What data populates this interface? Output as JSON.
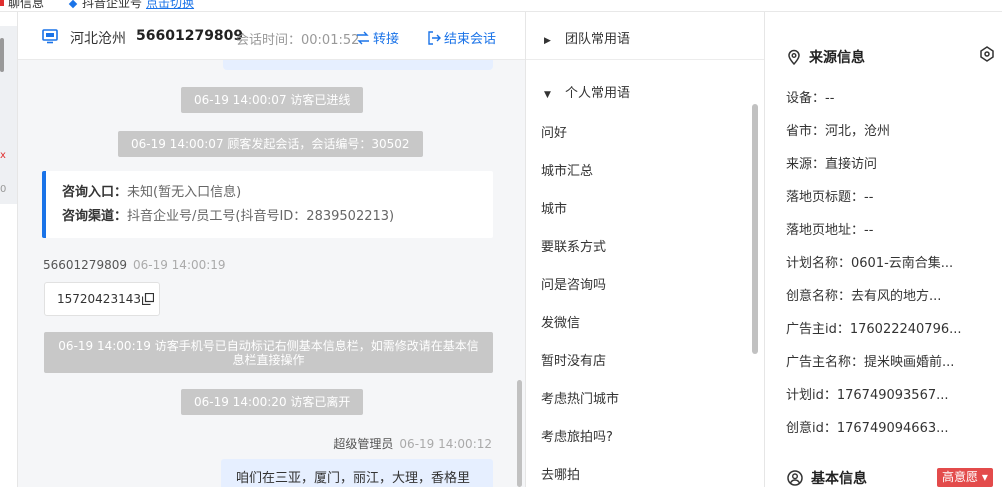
{
  "top_strip": {
    "fragment_left": "聊信息",
    "fragment_mid": "抖音企业号",
    "fragment_link": "点击切换"
  },
  "left_stub": {
    "tick_a": "x",
    "tick_b": "0"
  },
  "chat": {
    "header": {
      "region": "河北沧州",
      "visitor_id": "56601279809",
      "session_time_label": "会话时间：00:01:52",
      "transfer_label": "转接",
      "end_label": "结束会话"
    },
    "system_messages": {
      "entered": "06-19 14:00:07 访客已进线",
      "started": "06-19 14:00:07 顾客发起会话，会话编号：30502",
      "auto_mark": "06-19 14:00:19 访客手机号已自动标记右侧基本信息栏，如需修改请在基本信息栏直接操作",
      "left": "06-19 14:00:20 访客已离开"
    },
    "entry_card": {
      "entry_key": "咨询入口：",
      "entry_value": "未知(暂无入口信息)",
      "channel_key": "咨询渠道：",
      "channel_value": "抖音企业号/员工号(抖音号ID：2839502213)"
    },
    "customer_message": {
      "sender": "56601279809",
      "time": "06-19 14:00:19",
      "text": "15720423143"
    },
    "agent_message": {
      "sender": "超级管理员",
      "time": "06-19 14:00:12",
      "text": "咱们在三亚，厦门，丽江，大理，香格里"
    }
  },
  "phrases": {
    "team_group": "团队常用语",
    "personal_group": "个人常用语",
    "items": [
      "问好",
      "城市汇总",
      "城市",
      "要联系方式",
      "问是咨询吗",
      "发微信",
      "暂时没有店",
      "考虑热门城市",
      "考虑旅拍吗?",
      "去哪拍"
    ]
  },
  "info": {
    "source_title": "来源信息",
    "rows": [
      "设备：--",
      "省市：河北，沧州",
      "来源：直接访问",
      "落地页标题：--",
      "落地页地址：--",
      "计划名称：0601-云南合集...",
      "创意名称：去有风的地方...",
      "广告主id：176022240796...",
      "广告主名称：提米映画婚前...",
      "计划id：176749093567...",
      "创意id：176749094663..."
    ],
    "basic_title": "基本信息",
    "intent_tag": "高意愿"
  },
  "colors": {
    "accent": "#1a73e8",
    "system_bg": "#c8c8c8",
    "tag_red": "#e34b4b",
    "agent_bubble": "#e6efff"
  }
}
